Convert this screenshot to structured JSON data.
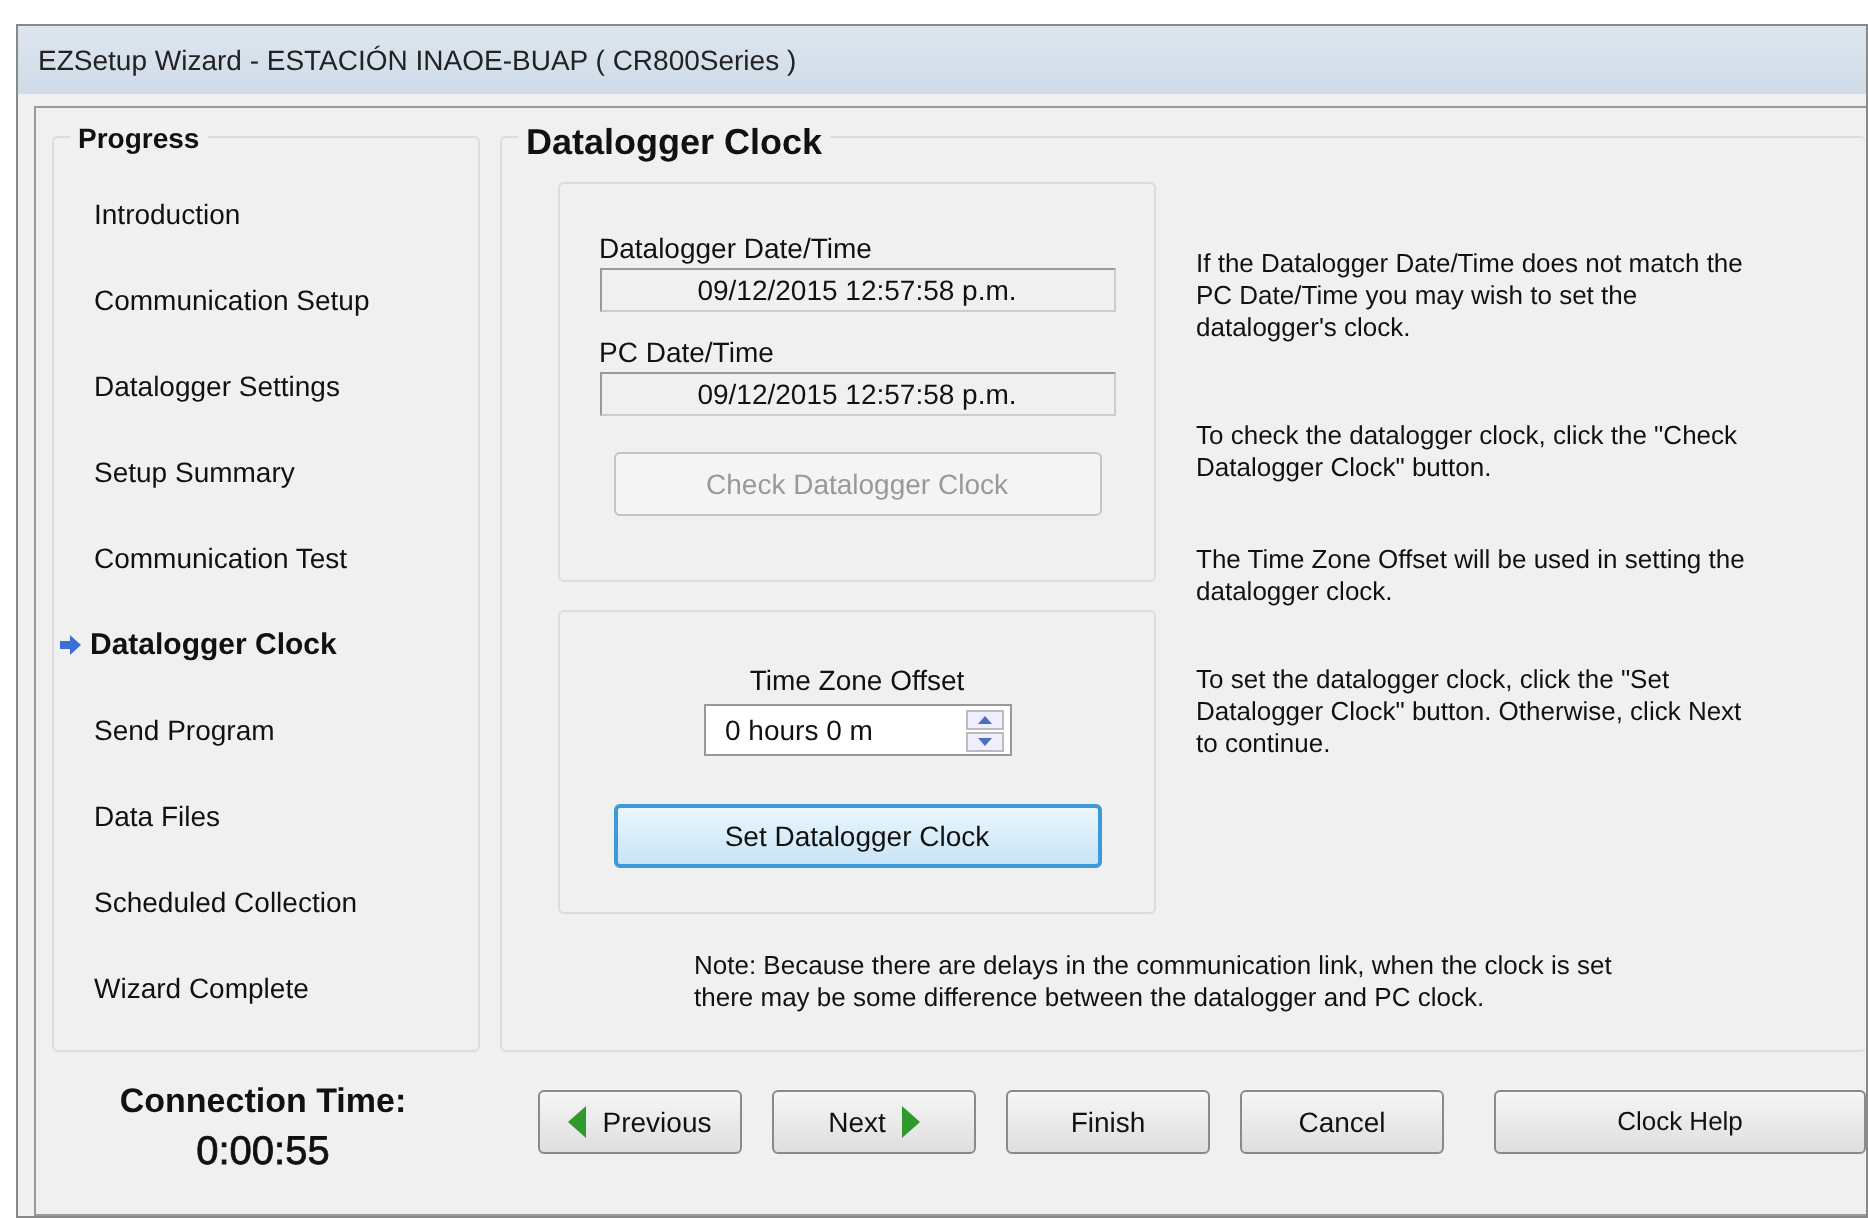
{
  "window": {
    "title": "EZSetup Wizard - ESTACIÓN INAOE-BUAP ( CR800Series )"
  },
  "progress": {
    "heading": "Progress",
    "steps": [
      {
        "label": "Introduction",
        "selected": false
      },
      {
        "label": "Communication Setup",
        "selected": false
      },
      {
        "label": "Datalogger Settings",
        "selected": false
      },
      {
        "label": "Setup Summary",
        "selected": false
      },
      {
        "label": "Communication Test",
        "selected": false
      },
      {
        "label": "Datalogger Clock",
        "selected": true
      },
      {
        "label": "Send Program",
        "selected": false
      },
      {
        "label": "Data Files",
        "selected": false
      },
      {
        "label": "Scheduled Collection",
        "selected": false
      },
      {
        "label": "Wizard Complete",
        "selected": false
      }
    ]
  },
  "connection": {
    "label": "Connection Time:",
    "value": "0:00:55"
  },
  "page": {
    "heading": "Datalogger Clock",
    "clock_group": {
      "datalogger_label": "Datalogger Date/Time",
      "datalogger_value": "09/12/2015 12:57:58 p.m.",
      "pc_label": "PC Date/Time",
      "pc_value": "09/12/2015 12:57:58 p.m.",
      "button": {
        "label": "Check Datalogger Clock",
        "disabled": true,
        "focused": false
      }
    },
    "clock_help": [
      "If the Datalogger Date/Time does not match the PC Date/Time you may wish to set the datalogger's clock.",
      "To check the datalogger clock, click the \"Check Datalogger Clock\" button."
    ],
    "offset_group": {
      "label": "Time Zone Offset",
      "value": "0 hours 0 m",
      "button": {
        "label": "Set Datalogger Clock",
        "disabled": false,
        "focused": true
      }
    },
    "offset_help": [
      "The Time Zone Offset will be used in setting the datalogger clock.",
      "To set the datalogger clock, click the \"Set Datalogger Clock\" button.  Otherwise, click Next to continue."
    ],
    "note": "Note: Because there are delays in the communication link, when the clock is set there may be some difference between the datalogger and PC clock."
  },
  "buttons": [
    {
      "kind": "previous",
      "label": "Previous"
    },
    {
      "kind": "next",
      "label": "Next"
    },
    {
      "kind": "plain",
      "label": "Finish"
    },
    {
      "kind": "plain",
      "label": "Cancel"
    },
    {
      "kind": "help",
      "label": "Clock Help"
    }
  ]
}
